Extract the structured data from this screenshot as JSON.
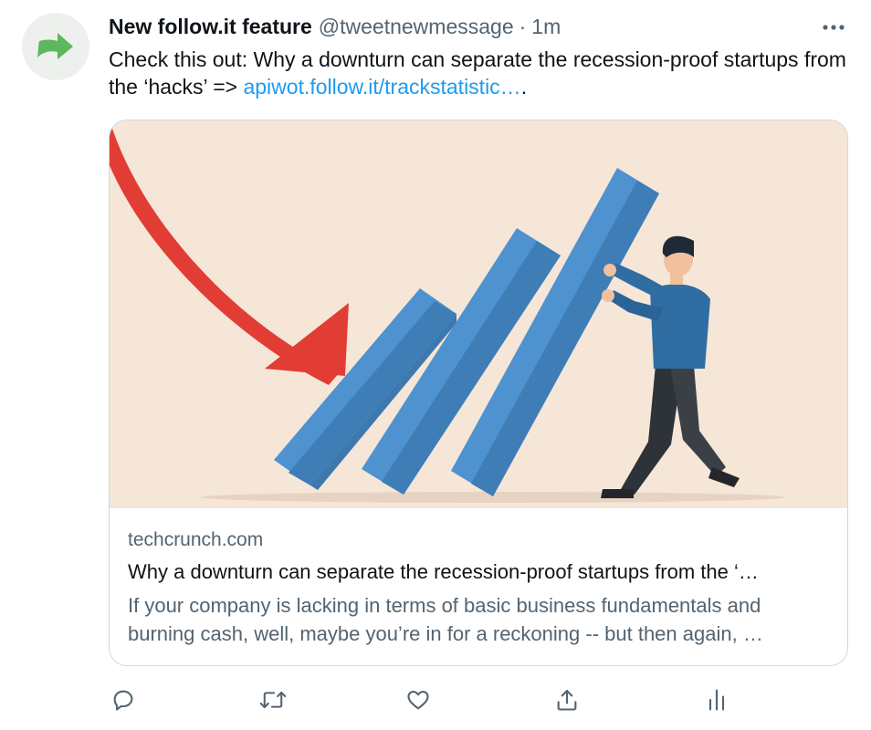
{
  "tweet": {
    "display_name": "New follow.it feature",
    "handle": "@tweetnewmessage",
    "separator": "·",
    "time": "1m",
    "text_prefix": "Check this out: Why a downturn can separate the recession-proof startups from the ‘hacks’ => ",
    "link_text": "apiwot.follow.it/trackstatistic…",
    "text_suffix": ".",
    "avatar_icon": "green-arrow-icon",
    "more_icon": "more-dots-icon"
  },
  "card": {
    "image_icon": "falling-bars-illustration",
    "domain": "techcrunch.com",
    "title": "Why a downturn can separate the recession-proof startups from the ‘…",
    "description": "If your company is lacking in terms of basic business fundamentals and burning cash, well, maybe you’re in for a reckoning -- but then again, …"
  },
  "actions": [
    {
      "icon": "reply-icon"
    },
    {
      "icon": "retweet-icon"
    },
    {
      "icon": "like-icon"
    },
    {
      "icon": "share-icon"
    },
    {
      "icon": "analytics-icon"
    }
  ],
  "colors": {
    "link": "#1d9bf0",
    "secondary_text": "#536471",
    "avatar_arrow": "#5cb85c",
    "image_background": "#f5e6d8"
  }
}
